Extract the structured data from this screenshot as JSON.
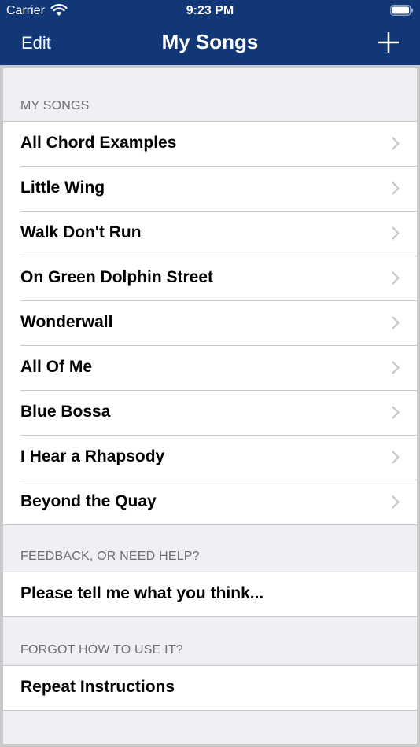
{
  "status_bar": {
    "carrier": "Carrier",
    "time": "9:23 PM"
  },
  "nav": {
    "edit_label": "Edit",
    "title": "My Songs",
    "add_icon": "plus-icon",
    "background_color": "#123777"
  },
  "songs_section": {
    "header": "MY SONGS",
    "items": [
      {
        "label": "All Chord Examples"
      },
      {
        "label": "Little Wing"
      },
      {
        "label": "Walk Don't Run"
      },
      {
        "label": "On Green Dolphin Street"
      },
      {
        "label": "Wonderwall"
      },
      {
        "label": "All Of Me"
      },
      {
        "label": "Blue Bossa"
      },
      {
        "label": "I Hear a Rhapsody"
      },
      {
        "label": "Beyond the Quay"
      }
    ]
  },
  "feedback_section": {
    "header": "FEEDBACK, OR NEED HELP?",
    "item": "Please tell me what you think..."
  },
  "help_section": {
    "header": "FORGOT HOW TO USE IT?",
    "item": "Repeat Instructions"
  }
}
